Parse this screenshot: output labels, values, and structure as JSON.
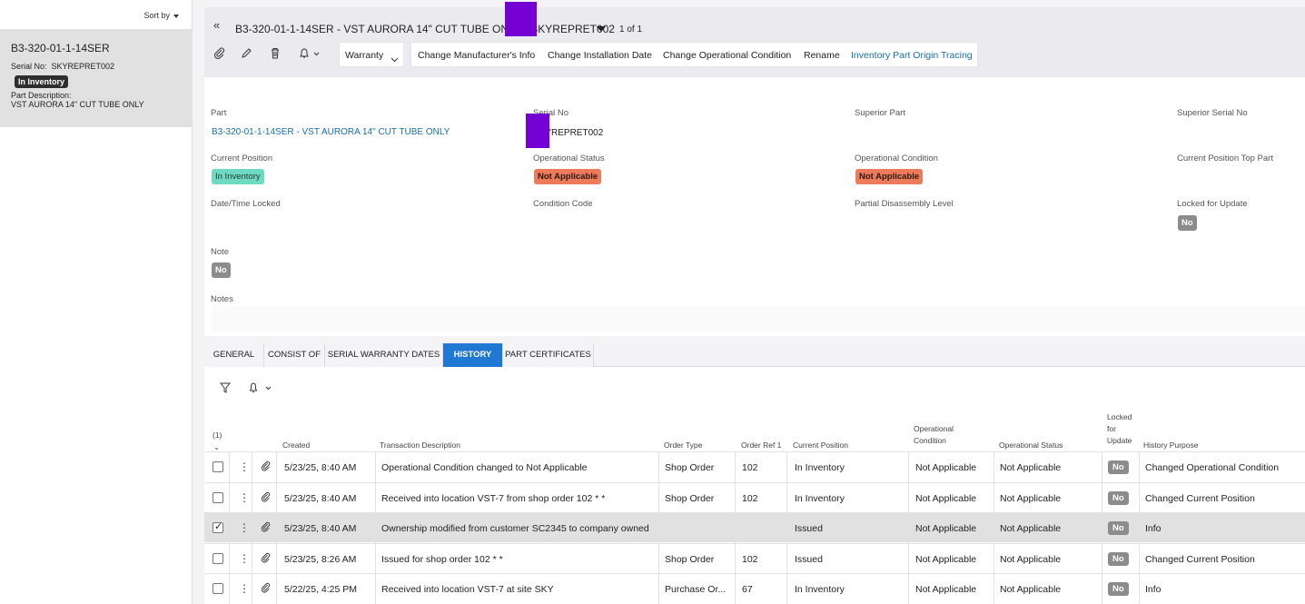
{
  "sidebar": {
    "sort_label": "Sort by",
    "card": {
      "title": "B3-320-01-1-14SER",
      "serial_label": "Serial No:",
      "serial_value": "SKYREPRET002",
      "status": "In Inventory",
      "part_desc_label": "Part Description:",
      "part_desc_value": "VST AURORA 14\" CUT TUBE ONLY"
    }
  },
  "header": {
    "title": "B3-320-01-1-14SER - VST AURORA 14\" CUT TUBE ONLY - SKYREPRET002",
    "record_count": "1 of 1"
  },
  "toolbar": {
    "warranty_label": "Warranty",
    "actions": [
      "Change Manufacturer's Info",
      "Change Installation Date",
      "Change Operational Condition",
      "Rename"
    ],
    "link_action": "Inventory Part Origin Tracing"
  },
  "detail": {
    "part_label": "Part",
    "part_value": "B3-320-01-1-14SER - VST AURORA 14\" CUT TUBE ONLY",
    "serial_label": "Serial No",
    "serial_value": "SKYREPRET002",
    "superior_part_label": "Superior Part",
    "superior_serial_label": "Superior Serial No",
    "current_position_label": "Current Position",
    "current_position_value": "In Inventory",
    "operational_status_label": "Operational Status",
    "operational_status_value": "Not Applicable",
    "operational_condition_label": "Operational Condition",
    "operational_condition_value": "Not Applicable",
    "current_position_top_label": "Current Position Top Part",
    "date_locked_label": "Date/Time Locked",
    "condition_code_label": "Condition Code",
    "partial_disassembly_label": "Partial Disassembly Level",
    "locked_for_update_label": "Locked for Update",
    "locked_for_update_value": "No",
    "note_label": "Note",
    "note_value": "No",
    "notes_label": "Notes"
  },
  "tabs": [
    "GENERAL",
    "CONSIST OF",
    "SERIAL WARRANTY DATES",
    "HISTORY",
    "PART CERTIFICATES"
  ],
  "grid": {
    "selected_count": "(1)",
    "columns": {
      "created": "Created",
      "description": "Transaction Description",
      "order_type": "Order Type",
      "order_ref": "Order Ref 1",
      "current_position": "Current Position",
      "op_condition": "Operational Condition",
      "op_status": "Operational Status",
      "locked": "Locked for Update",
      "purpose": "History Purpose"
    },
    "rows": [
      {
        "created": "5/23/25, 8:40 AM",
        "description": "Operational Condition changed to Not Applicable",
        "order_type": "Shop Order",
        "order_ref": "102",
        "position": "In Inventory",
        "op_condition": "Not Applicable",
        "op_status": "Not Applicable",
        "locked": "No",
        "purpose": "Changed Operational Condition",
        "checked": false
      },
      {
        "created": "5/23/25, 8:40 AM",
        "description": "Received into location VST-7 from shop order 102 * *",
        "order_type": "Shop Order",
        "order_ref": "102",
        "position": "In Inventory",
        "op_condition": "Not Applicable",
        "op_status": "Not Applicable",
        "locked": "No",
        "purpose": "Changed Current Position",
        "checked": false
      },
      {
        "created": "5/23/25, 8:40 AM",
        "description": "Ownership modified from customer SC2345 to company owned",
        "order_type": "",
        "order_ref": "",
        "position": "Issued",
        "op_condition": "Not Applicable",
        "op_status": "Not Applicable",
        "locked": "No",
        "purpose": "Info",
        "checked": true
      },
      {
        "created": "5/23/25, 8:26 AM",
        "description": "Issued for shop order 102 * *",
        "order_type": "Shop Order",
        "order_ref": "102",
        "position": "Issued",
        "op_condition": "Not Applicable",
        "op_status": "Not Applicable",
        "locked": "No",
        "purpose": "Changed Current Position",
        "checked": false
      },
      {
        "created": "5/22/25, 4:25 PM",
        "description": "Received into location VST-7 at site SKY",
        "order_type": "Purchase Or...",
        "order_ref": "67",
        "position": "In Inventory",
        "op_condition": "Not Applicable",
        "op_status": "Not Applicable",
        "locked": "No",
        "purpose": "Info",
        "checked": false
      }
    ]
  },
  "colors": {
    "accent": "#1f78d1",
    "link": "#1a6fa8",
    "badge_green": "#6fd9c1",
    "badge_red": "#ed7a5a",
    "badge_grey": "#8c8c8c",
    "redaction": "#7400d4"
  }
}
